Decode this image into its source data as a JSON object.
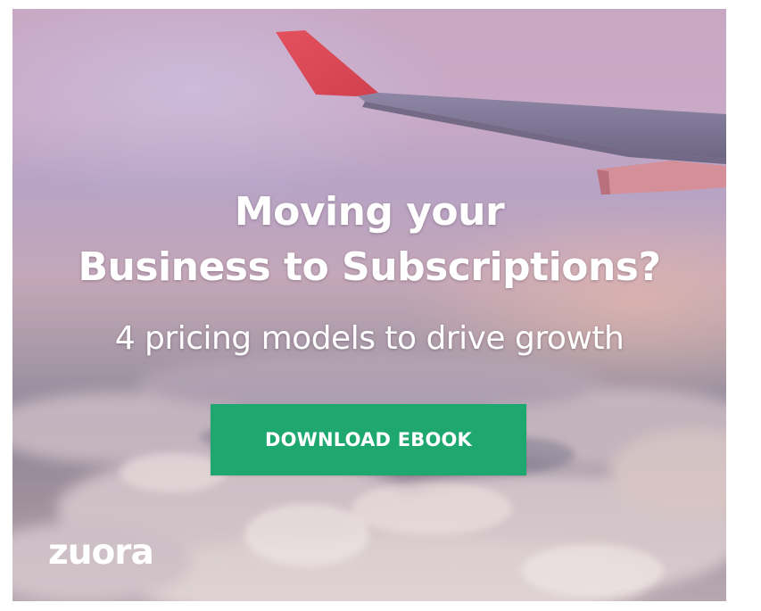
{
  "ad": {
    "headline_line1": "Moving your",
    "headline_line2": "Business to Subscriptions?",
    "subheadline": "4 pricing models to drive growth",
    "cta_label": "DOWNLOAD EBOOK",
    "brand_logo": "zuora"
  },
  "colors": {
    "cta_background": "#1ea870",
    "text": "#ffffff",
    "wing_tip": "#e0505a"
  },
  "icons": {
    "background": "airplane-wing-above-clouds-photo"
  }
}
